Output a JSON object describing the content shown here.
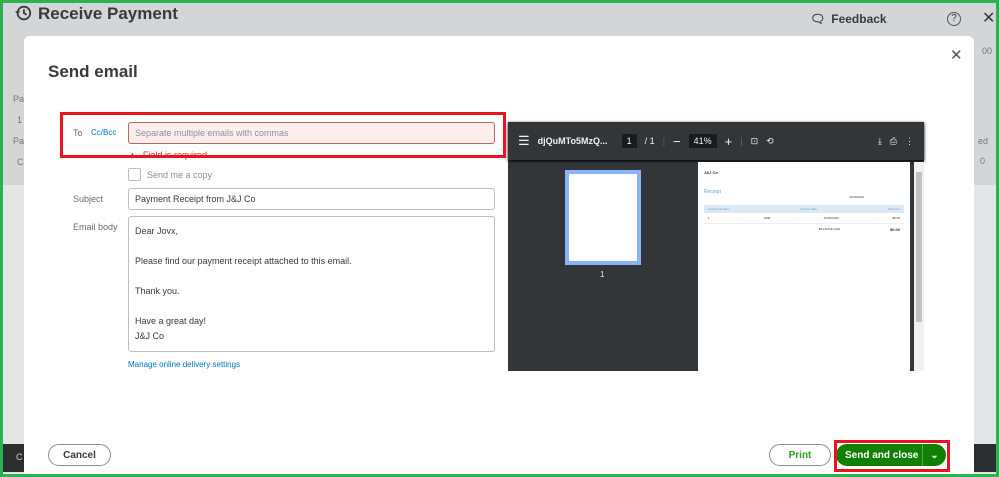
{
  "page": {
    "title": "Receive Payment",
    "feedback": "Feedback",
    "help": "?",
    "bg_fragments": [
      "Pa",
      "1",
      "Pa",
      "C",
      "00",
      "ed",
      "0",
      "C"
    ]
  },
  "modal": {
    "title": "Send email",
    "to_label": "To",
    "ccbcc": "Cc/Bcc",
    "to_placeholder": "Separate multiple emails with commas",
    "to_value": "",
    "error": "Field is required",
    "send_copy": "Send me a copy",
    "subject_label": "Subject",
    "subject": "Payment Receipt from J&J Co",
    "body_label": "Email body",
    "body_lines": [
      "Dear Jovx,",
      "",
      "Please find our payment receipt attached to this email.",
      "",
      "Thank you.",
      "",
      "Have a great day!",
      "J&J Co"
    ],
    "manage_link": "Manage online delivery settings",
    "cancel": "Cancel",
    "print": "Print",
    "send": "Send and close"
  },
  "pdf": {
    "filename": "djQuMTo5MzQ...",
    "page": "1",
    "total": "/ 1",
    "zoom": "41%",
    "thumb_label": "1",
    "doc": {
      "company": "J&J Co",
      "title": "Receipt",
      "headers": [
        "Invoice Number",
        "Invoice Date",
        "Payment"
      ],
      "row": [
        "1",
        "1008",
        "10/02/2024",
        "$0.00"
      ],
      "balance_label": "BALANCE DUE",
      "balance": "$0.00",
      "date": "11/26/2024"
    }
  },
  "colors": {
    "accent": "#108000",
    "link": "#0077c5",
    "error": "#d52b1e"
  }
}
